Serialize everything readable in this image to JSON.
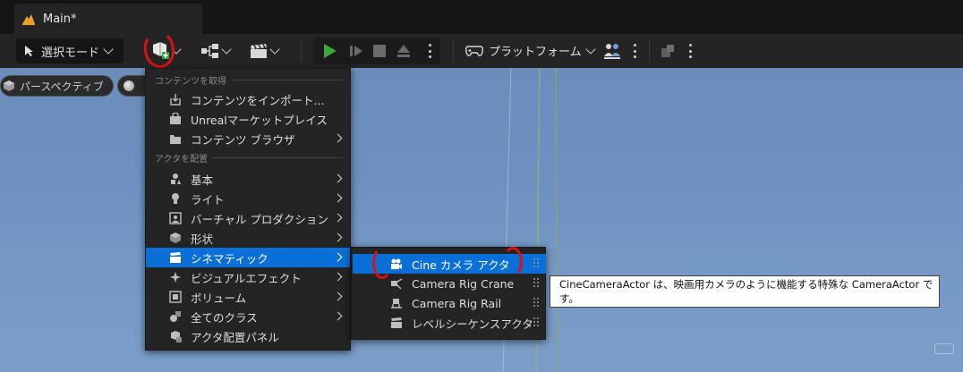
{
  "tab": {
    "title": "Main*"
  },
  "toolbar": {
    "select_mode": "選択モード",
    "platforms": "プラットフォーム"
  },
  "viewport": {
    "perspective_label": "パースペクティブ"
  },
  "menu": {
    "section_get_content": "コンテンツを取得",
    "section_place_actors": "アクタを配置",
    "items": [
      {
        "label": "コンテンツをインポート...",
        "icon": "import-icon"
      },
      {
        "label": "Unrealマーケットプレイス",
        "icon": "marketplace-icon"
      },
      {
        "label": "コンテンツ ブラウザ",
        "icon": "content-browser-icon"
      },
      {
        "label": "基本",
        "icon": "basic-icon"
      },
      {
        "label": "ライト",
        "icon": "light-bulb-icon"
      },
      {
        "label": "バーチャル プロダクション",
        "icon": "virtual-production-icon"
      },
      {
        "label": "形状",
        "icon": "shape-cube-icon"
      },
      {
        "label": "シネマティック",
        "icon": "clapper-icon"
      },
      {
        "label": "ビジュアルエフェクト",
        "icon": "visual-effects-icon"
      },
      {
        "label": "ボリューム",
        "icon": "volume-icon"
      },
      {
        "label": "全てのクラス",
        "icon": "all-classes-icon"
      },
      {
        "label": "アクタ配置パネル",
        "icon": "place-actors-panel-icon"
      }
    ]
  },
  "submenu": {
    "items": [
      {
        "label": "Cine カメラ アクタ",
        "icon": "cine-camera-icon"
      },
      {
        "label": "Camera Rig Crane",
        "icon": "rig-crane-icon"
      },
      {
        "label": "Camera Rig Rail",
        "icon": "rig-rail-icon"
      },
      {
        "label": "レベルシーケンスアクタ",
        "icon": "level-sequence-icon"
      }
    ]
  },
  "tooltip": {
    "text": "CineCameraActor は、映画用カメラのように機能する特殊な CameraActor です。"
  },
  "colors": {
    "accent": "#0a70d8",
    "annotation": "#e01010",
    "play_green": "#3aa83a"
  }
}
